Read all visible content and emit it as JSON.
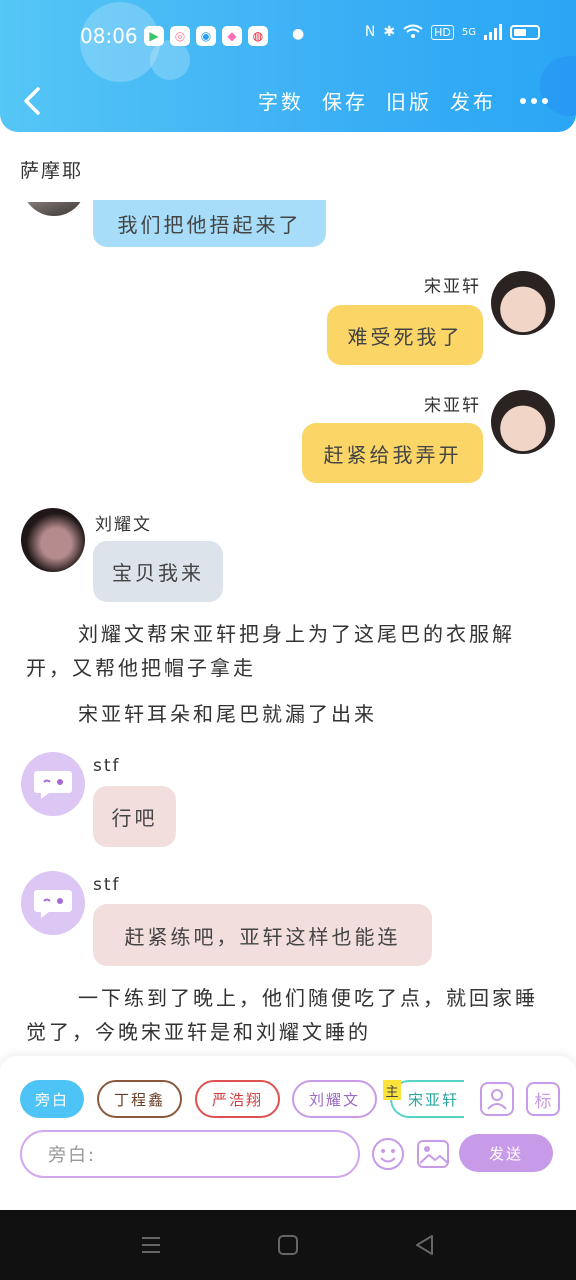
{
  "status_bar": {
    "time": "08:06",
    "network_label": "5G",
    "hd_label": "HD"
  },
  "header": {
    "toolbar": [
      "字数",
      "保存",
      "旧版",
      "发布"
    ]
  },
  "chat": {
    "title": "萨摩耶",
    "messages": [
      {
        "type": "bubble",
        "side": "left",
        "text": "我们把他捂起来了",
        "color": "#a7ddf8"
      },
      {
        "type": "bubble",
        "side": "right",
        "speaker": "宋亚轩",
        "text": "难受死我了",
        "color": "#fbd667"
      },
      {
        "type": "bubble",
        "side": "right",
        "speaker": "宋亚轩",
        "text": "赶紧给我弄开",
        "color": "#fbd667"
      },
      {
        "type": "bubble",
        "side": "left",
        "speaker": "刘耀文",
        "text": "宝贝我来",
        "color": "#dde3ea"
      },
      {
        "type": "narration",
        "text": "刘耀文帮宋亚轩把身上为了这尾巴的衣服解开，又帮他把帽子拿走"
      },
      {
        "type": "narration",
        "text": "宋亚轩耳朵和尾巴就漏了出来"
      },
      {
        "type": "bubble",
        "side": "left",
        "speaker": "stf",
        "text": "行吧",
        "color": "#f3dede"
      },
      {
        "type": "bubble",
        "side": "left",
        "speaker": "stf",
        "text": "赶紧练吧，亚轩这样也能连",
        "color": "#f3dede"
      },
      {
        "type": "narration",
        "text": "一下练到了晚上，他们随便吃了点，就回家睡觉了，今晚宋亚轩是和刘耀文睡的"
      }
    ]
  },
  "composer": {
    "roles": [
      "旁白",
      "丁程鑫",
      "严浩翔",
      "刘耀文",
      "宋亚轩"
    ],
    "main_tag": "主",
    "input_placeholder": "旁白:",
    "send_label": "发送",
    "icon_tag_label": "标"
  }
}
